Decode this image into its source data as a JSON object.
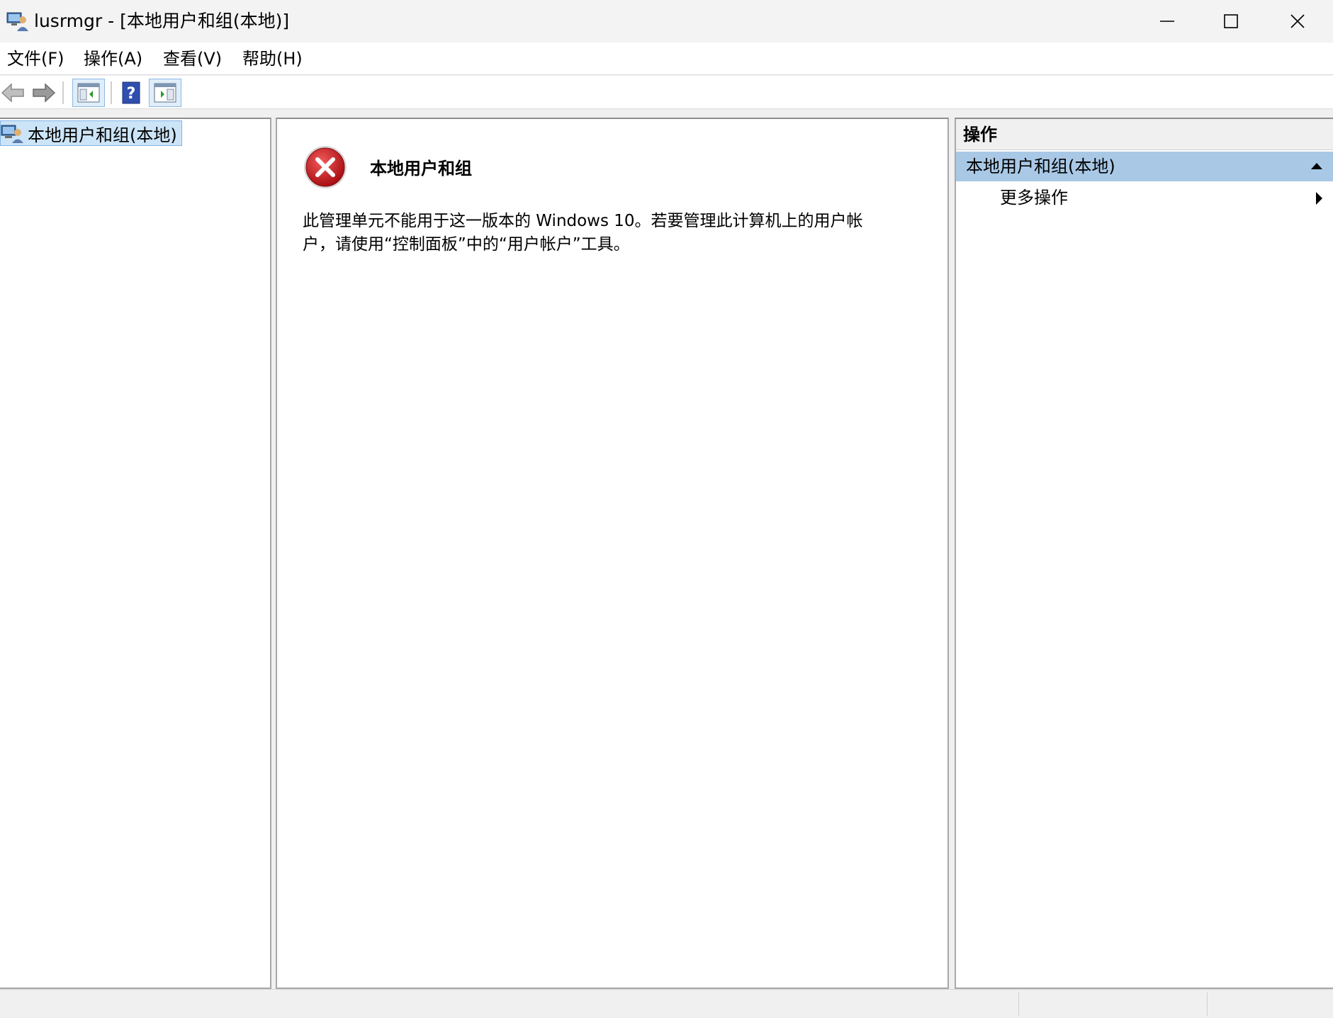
{
  "window": {
    "title": "lusrmgr - [本地用户和组(本地)]",
    "app_icon": "computer-users-icon",
    "controls": {
      "minimize": "minimize-icon",
      "maximize": "maximize-icon",
      "close": "close-icon"
    }
  },
  "menu": {
    "items": [
      {
        "label": "文件(F)"
      },
      {
        "label": "操作(A)"
      },
      {
        "label": "查看(V)"
      },
      {
        "label": "帮助(H)"
      }
    ]
  },
  "toolbar": {
    "buttons": [
      "back-arrow-icon",
      "forward-arrow-icon",
      "show-hide-console-tree-icon",
      "help-icon",
      "show-hide-action-pane-icon"
    ]
  },
  "tree": {
    "root_label": "本地用户和组(本地)",
    "root_icon": "computer-users-icon"
  },
  "content": {
    "heading": "本地用户和组",
    "message": "此管理单元不能用于这一版本的 Windows 10。若要管理此计算机上的用户帐户，请使用“控制面板”中的“用户帐户”工具。",
    "icon": "error-icon"
  },
  "actions": {
    "header": "操作",
    "group_label": "本地用户和组(本地)",
    "items": [
      {
        "label": "更多操作"
      }
    ]
  },
  "colors": {
    "selection": "#cce4f7",
    "action_group": "#a9c8e6",
    "error_red": "#c4161c"
  }
}
